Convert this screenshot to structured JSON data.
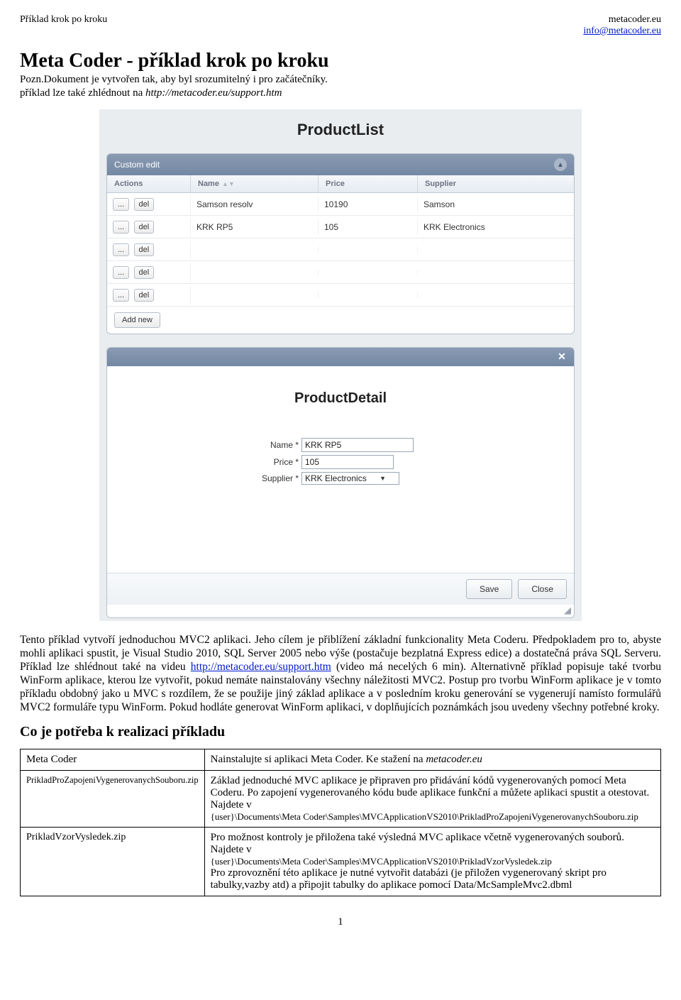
{
  "header": {
    "left": "Příklad krok po kroku",
    "right_line1": "metacoder.eu",
    "right_link": "info@metacoder.eu"
  },
  "title": "Meta Coder - příklad krok po kroku",
  "subtitle": "Pozn.Dokument je vytvořen tak, aby byl srozumitelný i pro začátečníky.",
  "support_prefix": "příklad lze také zhlédnout na ",
  "support_url_text": "http://metacoder.eu/support.htm",
  "screenshot": {
    "list_title": "ProductList",
    "panel_header": "Custom edit",
    "columns": {
      "actions": "Actions",
      "name": "Name",
      "price": "Price",
      "supplier": "Supplier"
    },
    "btn_more": "...",
    "btn_del": "del",
    "btn_add_new": "Add new",
    "rows": [
      {
        "name": "Samson resolv",
        "price": "10190",
        "supplier": "Samson"
      },
      {
        "name": "KRK RP5",
        "price": "105",
        "supplier": "KRK Electronics"
      },
      {
        "name": "",
        "price": "",
        "supplier": ""
      },
      {
        "name": "",
        "price": "",
        "supplier": ""
      },
      {
        "name": "",
        "price": "",
        "supplier": ""
      }
    ],
    "detail_title": "ProductDetail",
    "form": {
      "name_label": "Name *",
      "name_value": "KRK RP5",
      "price_label": "Price *",
      "price_value": "105",
      "supplier_label": "Supplier *",
      "supplier_value": "KRK Electronics"
    },
    "btn_save": "Save",
    "btn_close": "Close"
  },
  "paragraph_a": "Tento příklad vytvoří jednoduchou MVC2 aplikaci. Jeho cílem je přiblížení základní funkcionality Meta Coderu. Předpokladem pro to, abyste mohli aplikaci spustit, je Visual Studio 2010, SQL Server 2005 nebo výše (postačuje bezplatná Express edice) a dostatečná práva SQL Serveru. Příklad lze shlédnout také na videu ",
  "paragraph_link": "http://metacoder.eu/support.htm",
  "paragraph_b": " (video má necelých 6 min). Alternativně příklad popisuje také tvorbu WinForm aplikace, kterou lze vytvořit, pokud nemáte nainstalovány všechny náležitosti MVC2. Postup pro tvorbu WinForm aplikace je v tomto příkladu obdobný jako u MVC s rozdílem, že se použije jiný základ aplikace a v posledním kroku generování se vygenerují namísto formulářů MVC2 formuláře typu WinForm. Pokud hodláte generovat WinForm aplikaci, v doplňujících poznámkách jsou uvedeny všechny potřebné kroky.",
  "section_heading": "Co je potřeba k realizaci příkladu",
  "table": {
    "row1_left": "Meta Coder",
    "row1_right_a": "Nainstalujte si aplikaci Meta Coder.  Ke stažení na ",
    "row1_right_b": "metacoder.eu",
    "row2_left": "PrikladProZapojeniVygenerovanychSouboru.zip",
    "row2_right_p1": "Základ jednoduché MVC aplikace je připraven pro přidávání kódů vygenerovaných pomocí Meta Coderu. Po zapojení vygenerovaného kódu bude aplikace funkční a můžete aplikaci spustit a otestovat.  Najdete  v",
    "row2_right_path1": "{user}\\Documents\\Meta Coder\\Samples\\MVCApplicationVS2010\\PrikladProZapojeniVygenerovanychSouboru.zip",
    "row3_left": "PrikladVzorVysledek.zip",
    "row3_right_p1": "Pro možnost kontroly je přiložena také výsledná MVC aplikace včetně vygenerovaných souborů.  Najdete v",
    "row3_right_path1": "{user}\\Documents\\Meta Coder\\Samples\\MVCApplicationVS2010\\PrikladVzorVysledek.zip",
    "row3_right_p2": "Pro zprovoznění této aplikace je nutné vytvořit databázi (je přiložen vygenerovaný skript pro tabulky,vazby atd) a připojit tabulky do aplikace pomocí Data/McSampleMvc2.dbml"
  },
  "page_number": "1"
}
